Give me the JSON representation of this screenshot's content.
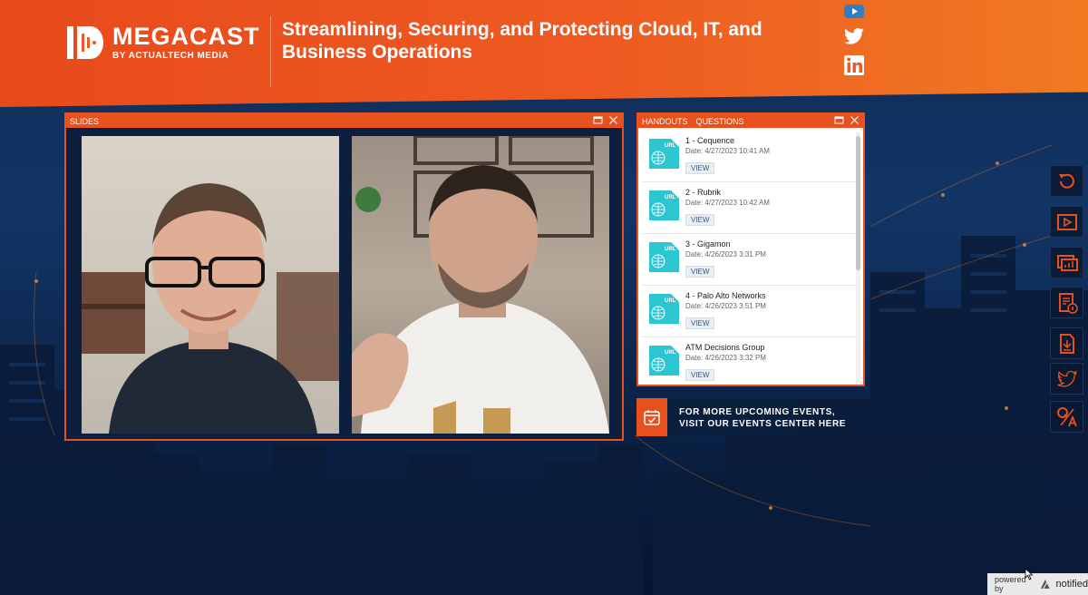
{
  "header": {
    "logo_name": "MEGACAST",
    "logo_sub": "BY ACTUALTECH MEDIA",
    "headline_line1": "Streamlining, Securing, and Protecting Cloud, IT, and",
    "headline_line2": "Business Operations"
  },
  "social": [
    "youtube-icon",
    "twitter-icon",
    "linkedin-icon"
  ],
  "slides_panel": {
    "title": "SLIDES"
  },
  "handouts_panel": {
    "tabs": [
      "HANDOUTS",
      "QUESTIONS"
    ],
    "items": [
      {
        "title": "1 - Cequence",
        "date": "Date: 4/27/2023 10:41 AM",
        "button": "VIEW",
        "icon_label": "URL"
      },
      {
        "title": "2 - Rubrik",
        "date": "Date: 4/27/2023 10:42 AM",
        "button": "VIEW",
        "icon_label": "URL"
      },
      {
        "title": "3 - Gigamon",
        "date": "Date: 4/26/2023 3:31 PM",
        "button": "VIEW",
        "icon_label": "URL"
      },
      {
        "title": "4 - Palo Alto Networks",
        "date": "Date: 4/26/2023 3:51 PM",
        "button": "VIEW",
        "icon_label": "URL"
      },
      {
        "title": "ATM Decisions Group",
        "date": "Date: 4/26/2023 3:32 PM",
        "button": "VIEW",
        "icon_label": "URL"
      }
    ]
  },
  "events": {
    "line1": "FOR MORE UPCOMING EVENTS,",
    "line2": "VISIT OUR EVENTS CENTER HERE"
  },
  "side_toolbar": [
    "refresh-icon",
    "play-icon",
    "slides-icon",
    "info-icon",
    "download-icon",
    "twitter-icon",
    "qa-icon"
  ],
  "footer": {
    "powered_by": "powered by",
    "brand": "notified"
  },
  "colors": {
    "accent": "#e8501d",
    "panel_bg": "#0c1f3e",
    "url_icon": "#2cc6d3"
  }
}
